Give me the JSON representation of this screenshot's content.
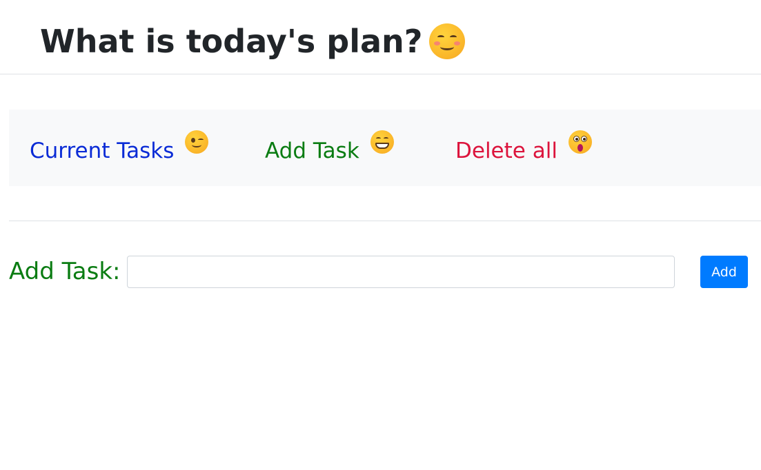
{
  "header": {
    "title": "What is today's plan?",
    "title_emoji": "smiling-face-with-smiling-eyes-icon"
  },
  "nav": {
    "items": [
      {
        "label": "Current Tasks",
        "emoji": "winking-face-icon",
        "color": "#0a2bd6"
      },
      {
        "label": "Add Task",
        "emoji": "grinning-face-icon",
        "color": "#0a7c12"
      },
      {
        "label": "Delete all",
        "emoji": "astonished-face-icon",
        "color": "#dc143c"
      }
    ],
    "background": "#f8f9fa"
  },
  "add_form": {
    "label": "Add Task:",
    "input_value": "",
    "input_placeholder": "",
    "button_label": "Add",
    "button_color": "#007bff"
  }
}
